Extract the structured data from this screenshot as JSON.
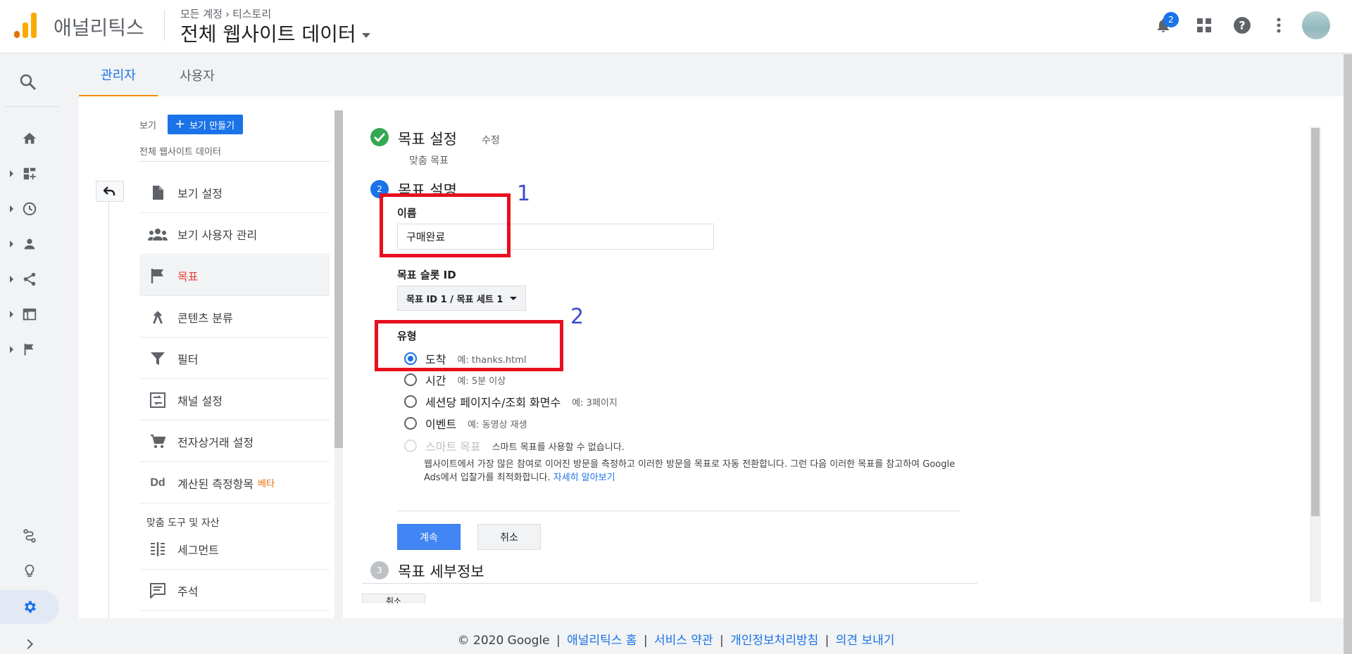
{
  "header": {
    "brand": "애널리틱스",
    "breadcrumb": {
      "account": "모든 계정",
      "property": "티스토리"
    },
    "view_title": "전체 웹사이트 데이터",
    "notification_count": "2",
    "colors": {
      "logo_orange": "#f9ab00",
      "logo_dark_orange": "#e37400",
      "accent": "#1a73e8"
    }
  },
  "rail": {
    "icons": [
      "search-icon",
      "home-icon",
      "customization-icon",
      "realtime-icon",
      "audience-icon",
      "acquisition-icon",
      "behavior-icon",
      "conversions-icon",
      "attribution-icon",
      "discover-icon",
      "admin-gear-icon",
      "expand-icon"
    ]
  },
  "tabs": [
    {
      "label": "관리자",
      "active": true
    },
    {
      "label": "사용자",
      "active": false
    }
  ],
  "left_menu": {
    "view_label": "보기",
    "create_view_label": "보기 만들기",
    "view_name": "전체 웹사이트 데이터",
    "items": [
      {
        "label": "보기 설정",
        "icon": "document-icon"
      },
      {
        "label": "보기 사용자 관리",
        "icon": "users-icon"
      },
      {
        "label": "목표",
        "icon": "flag-icon",
        "active": true
      },
      {
        "label": "콘텐츠 분류",
        "icon": "content-grouping-icon"
      },
      {
        "label": "필터",
        "icon": "filter-icon"
      },
      {
        "label": "채널 설정",
        "icon": "channel-settings-icon"
      },
      {
        "label": "전자상거래 설정",
        "icon": "cart-icon"
      },
      {
        "label": "계산된 측정항목",
        "icon": "dd-icon",
        "badge": "베타"
      }
    ],
    "section_label": "맞춤 도구 및 자산",
    "tools": [
      {
        "label": "세그먼트",
        "icon": "segments-icon"
      },
      {
        "label": "주석",
        "icon": "annotation-icon"
      }
    ]
  },
  "goal": {
    "step1": {
      "title": "목표 설정",
      "edit": "수정",
      "subtitle": "맞춤 목표"
    },
    "step2": {
      "number": "2",
      "title": "목표 설명",
      "name_label": "이름",
      "name_value": "구매완료",
      "slot_label": "목표 슬롯 ID",
      "slot_value": "목표 ID 1 / 목표 세트 1",
      "type_label": "유형",
      "types": [
        {
          "label": "도착",
          "example": "예: thanks.html",
          "selected": true
        },
        {
          "label": "시간",
          "example": "예: 5분 이상",
          "selected": false
        },
        {
          "label": "세션당 페이지수/조회 화면수",
          "example": "예: 3페이지",
          "selected": false
        },
        {
          "label": "이벤트",
          "example": "예: 동영상 재생",
          "selected": false
        },
        {
          "label": "스마트 목표",
          "example": "스마트 목표를 사용할 수 없습니다.",
          "selected": false,
          "disabled": true
        }
      ],
      "smart_desc": "웹사이트에서 가장 많은 참여로 이어진 방문을 측정하고 이러한 방문을 목표로 자동 전환합니다. 그런 다음 이러한 목표를 참고하여 Google Ads에서 입찰가를 최적화합니다. ",
      "learn_more": "자세히 알아보기",
      "continue_label": "계속",
      "cancel_label": "취소"
    },
    "step3": {
      "number": "3",
      "title": "목표 세부정보"
    },
    "partial_button": "취소"
  },
  "annotations": {
    "one": "1",
    "two": "2"
  },
  "footer": {
    "copyright": "© 2020 Google",
    "links": [
      "애널리틱스 홈",
      "서비스 약관",
      "개인정보처리방침",
      "의견 보내기"
    ],
    "separator": "|"
  }
}
